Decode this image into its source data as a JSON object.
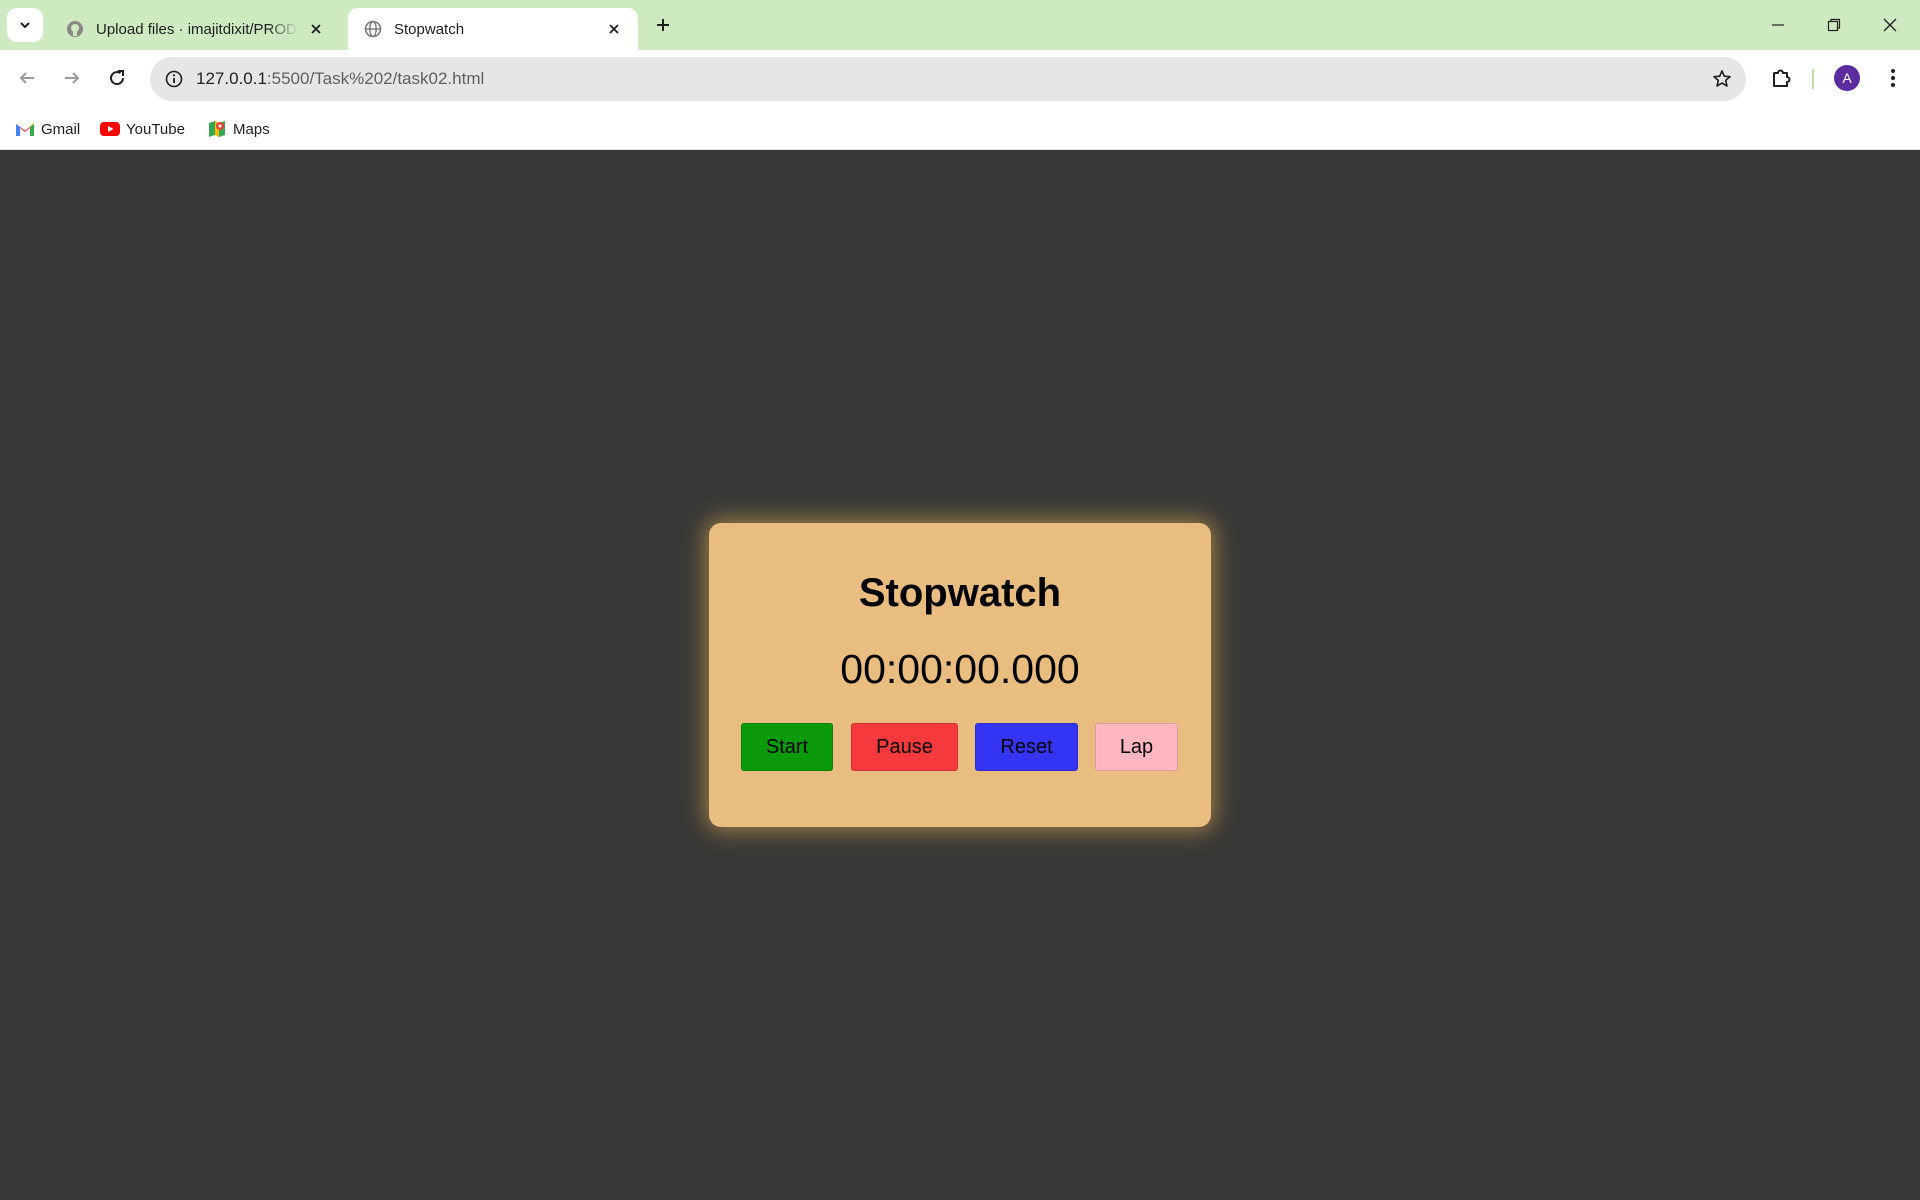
{
  "browser": {
    "tabs": [
      {
        "title": "Upload files · imajitdixit/PRODIGY",
        "favicon": "github-icon",
        "active": false
      },
      {
        "title": "Stopwatch",
        "favicon": "globe-icon",
        "active": true
      }
    ],
    "address": {
      "host": "127.0.0.1",
      "path": ":5500/Task%202/task02.html"
    },
    "profile_initial": "A",
    "bookmarks": [
      {
        "label": "Gmail",
        "icon": "gmail-icon"
      },
      {
        "label": "YouTube",
        "icon": "youtube-icon"
      },
      {
        "label": "Maps",
        "icon": "maps-icon"
      }
    ]
  },
  "stopwatch": {
    "title": "Stopwatch",
    "time": "00:00:00.000",
    "buttons": {
      "start": "Start",
      "pause": "Pause",
      "reset": "Reset",
      "lap": "Lap"
    }
  },
  "colors": {
    "page_bg": "#3a3937",
    "card_bg": "#e9bd7f",
    "start": "#0a9a0a",
    "pause": "#f5393c",
    "reset": "#3434f5",
    "lap": "#ffb6c1",
    "tabstrip": "#cdeac0"
  }
}
